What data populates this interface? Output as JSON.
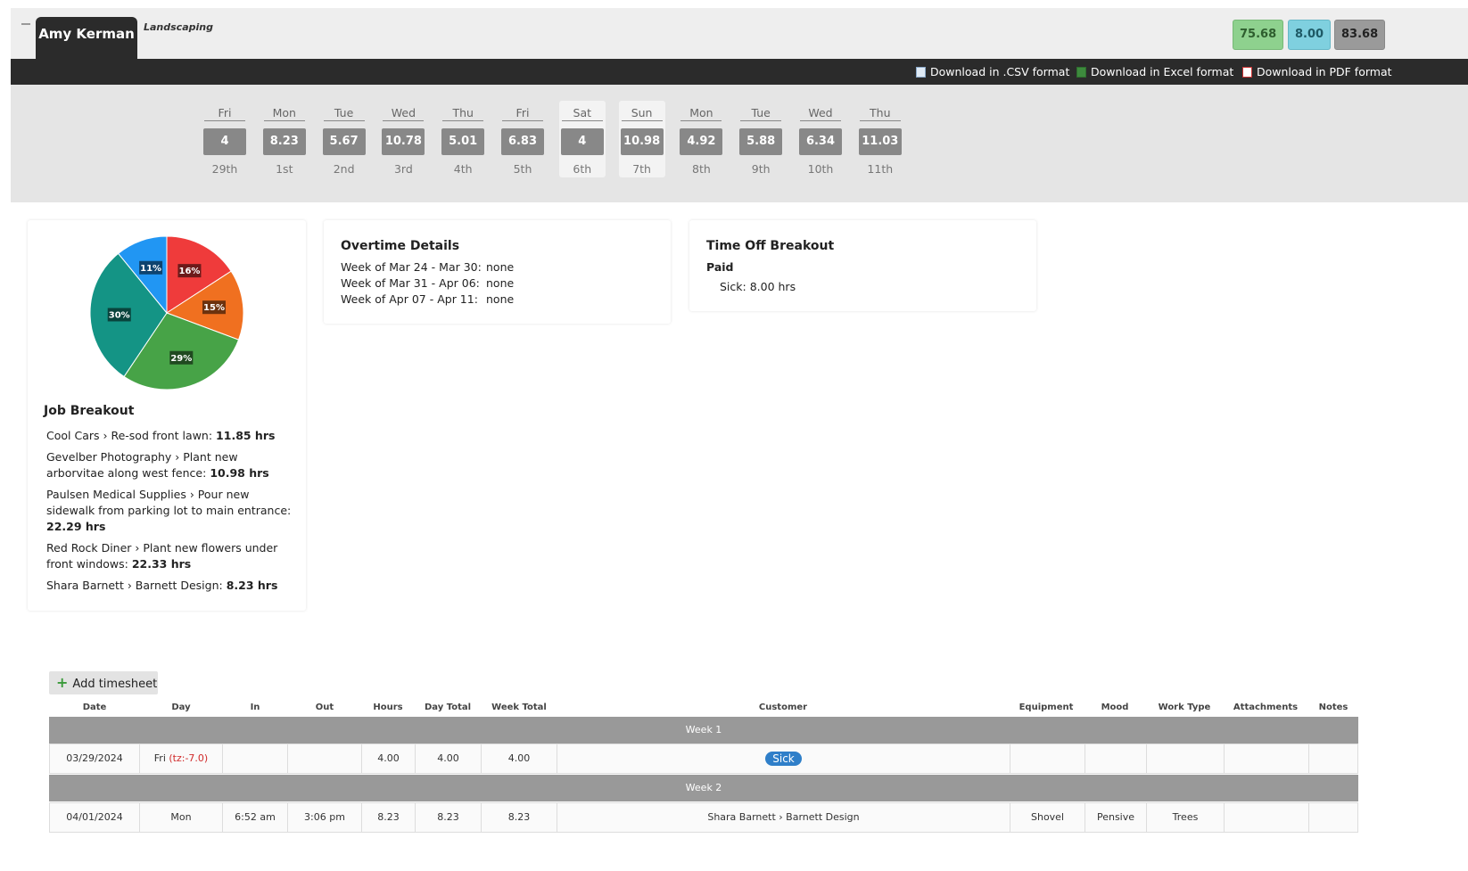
{
  "header": {
    "employee_name": "Amy Kerman",
    "department": "Landscaping",
    "totals": {
      "regular": "75.68",
      "time_off": "8.00",
      "total": "83.68"
    },
    "colors": {
      "regular": "#8ed18e",
      "time_off": "#7fd0df",
      "total": "#9a9a9a"
    }
  },
  "downloads": [
    {
      "label": "Download in .CSV format",
      "icon": "csv-file-icon"
    },
    {
      "label": "Download in Excel format",
      "icon": "excel-file-icon"
    },
    {
      "label": "Download in PDF format",
      "icon": "pdf-file-icon"
    }
  ],
  "days": [
    {
      "name": "Fri",
      "hours": "4",
      "date": "29th",
      "weekend": false
    },
    {
      "name": "Mon",
      "hours": "8.23",
      "date": "1st",
      "weekend": false
    },
    {
      "name": "Tue",
      "hours": "5.67",
      "date": "2nd",
      "weekend": false
    },
    {
      "name": "Wed",
      "hours": "10.78",
      "date": "3rd",
      "weekend": false
    },
    {
      "name": "Thu",
      "hours": "5.01",
      "date": "4th",
      "weekend": false
    },
    {
      "name": "Fri",
      "hours": "6.83",
      "date": "5th",
      "weekend": false
    },
    {
      "name": "Sat",
      "hours": "4",
      "date": "6th",
      "weekend": true
    },
    {
      "name": "Sun",
      "hours": "10.98",
      "date": "7th",
      "weekend": true
    },
    {
      "name": "Mon",
      "hours": "4.92",
      "date": "8th",
      "weekend": false
    },
    {
      "name": "Tue",
      "hours": "5.88",
      "date": "9th",
      "weekend": false
    },
    {
      "name": "Wed",
      "hours": "6.34",
      "date": "10th",
      "weekend": false
    },
    {
      "name": "Thu",
      "hours": "11.03",
      "date": "11th",
      "weekend": false
    }
  ],
  "chart_data": {
    "type": "pie",
    "slices": [
      {
        "label": "16%",
        "value": 16,
        "color": "#ef3b3b"
      },
      {
        "label": "15%",
        "value": 15,
        "color": "#f07020"
      },
      {
        "label": "29%",
        "value": 29,
        "color": "#47a347"
      },
      {
        "label": "30%",
        "value": 30,
        "color": "#149485"
      },
      {
        "label": "11%",
        "value": 11,
        "color": "#2196f3"
      }
    ]
  },
  "job_breakout": {
    "title": "Job Breakout",
    "items": [
      {
        "name": "Cool Cars › Re-sod front lawn:",
        "hours": "11.85 hrs"
      },
      {
        "name": "Gevelber Photography › Plant new arborvitae along west fence:",
        "hours": "10.98 hrs"
      },
      {
        "name": "Paulsen Medical Supplies › Pour new sidewalk from parking lot to main entrance:",
        "hours": "22.29 hrs"
      },
      {
        "name": "Red Rock Diner › Plant new flowers under front windows:",
        "hours": "22.33 hrs"
      },
      {
        "name": "Shara Barnett › Barnett Design:",
        "hours": "8.23 hrs"
      }
    ]
  },
  "overtime": {
    "title": "Overtime Details",
    "rows": [
      {
        "week": "Week of Mar 24 - Mar 30:",
        "value": "none"
      },
      {
        "week": "Week of Mar 31 - Apr 06:",
        "value": "none"
      },
      {
        "week": "Week of Apr 07 - Apr 11:",
        "value": "none"
      }
    ]
  },
  "time_off": {
    "title": "Time Off Breakout",
    "subtitle": "Paid",
    "line": "Sick: 8.00 hrs"
  },
  "table": {
    "add_label": "Add timesheet",
    "columns": [
      "Date",
      "Day",
      "In",
      "Out",
      "Hours",
      "Day Total",
      "Week Total",
      "Customer",
      "Equipment",
      "Mood",
      "Work Type",
      "Attachments",
      "Notes"
    ],
    "week1_label": "Week 1",
    "week2_label": "Week 2",
    "row1": {
      "date": "03/29/2024",
      "day": "Fri",
      "tz": "(tz:-7.0)",
      "in": "",
      "out": "",
      "hours": "4.00",
      "day_total": "4.00",
      "week_total": "4.00",
      "customer": "Sick",
      "equipment": "",
      "mood": "",
      "work_type": ""
    },
    "row2": {
      "date": "04/01/2024",
      "day": "Mon",
      "in": "6:52 am",
      "out": "3:06 pm",
      "hours": "8.23",
      "day_total": "8.23",
      "week_total": "8.23",
      "customer": "Shara Barnett › Barnett Design",
      "equipment": "Shovel",
      "mood": "Pensive",
      "work_type": "Trees"
    }
  }
}
